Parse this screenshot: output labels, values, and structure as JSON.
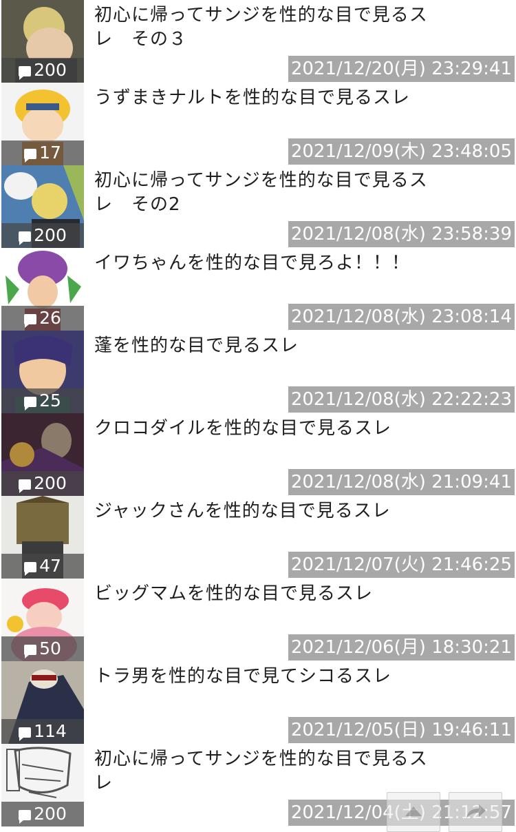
{
  "threads": [
    {
      "title": "初心に帰ってサンジを性的な目で見るスレ　その３",
      "count": "200",
      "date": "2021/12/20(月) 23:29:41",
      "thumb": {
        "bg": "#5b5a4a",
        "accent": "#d8c77a"
      }
    },
    {
      "title": "うずまきナルトを性的な目で見るスレ",
      "count": "17",
      "date": "2021/12/09(木) 23:48:05",
      "thumb": {
        "bg": "#f3f3f3",
        "accent": "#f2c230"
      }
    },
    {
      "title": "初心に帰ってサンジを性的な目で見るスレ　その2",
      "count": "200",
      "date": "2021/12/08(水) 23:58:39",
      "thumb": {
        "bg": "#4f7fb0",
        "accent": "#e7d36a"
      }
    },
    {
      "title": "イワちゃんを性的な目で見ろよ！！！",
      "count": "26",
      "date": "2021/12/08(水) 23:08:14",
      "thumb": {
        "bg": "#ffffff",
        "accent": "#8a4aa8"
      }
    },
    {
      "title": "蓬を性的な目で見るスレ",
      "count": "25",
      "date": "2021/12/08(水) 22:22:23",
      "thumb": {
        "bg": "#3d3a6e",
        "accent": "#f0c9a0"
      }
    },
    {
      "title": "クロコダイルを性的な目で見るスレ",
      "count": "200",
      "date": "2021/12/08(水) 21:09:41",
      "thumb": {
        "bg": "#3a2530",
        "accent": "#b08a3a"
      }
    },
    {
      "title": "ジャックさんを性的な目で見るスレ",
      "count": "47",
      "date": "2021/12/07(火) 21:46:25",
      "thumb": {
        "bg": "#e8e8e4",
        "accent": "#7a6a40"
      }
    },
    {
      "title": "ビッグマムを性的な目で見るスレ",
      "count": "50",
      "date": "2021/12/06(月) 18:30:21",
      "thumb": {
        "bg": "#f7f4f4",
        "accent": "#e98fa8"
      }
    },
    {
      "title": "トラ男を性的な目で見てシコるスレ",
      "count": "114",
      "date": "2021/12/05(日) 19:46:11",
      "thumb": {
        "bg": "#b8b1a6",
        "accent": "#2a3048"
      }
    },
    {
      "title": "初心に帰ってサンジを性的な目で見るスレ",
      "count": "200",
      "date": "2021/12/04(土) 21:12:57",
      "thumb": {
        "bg": "#f4f4f4",
        "accent": "#555555"
      }
    }
  ],
  "floating": {
    "scroll_top_icon": "up-arrow-icon",
    "share_icon": "share-arrow-icon"
  }
}
